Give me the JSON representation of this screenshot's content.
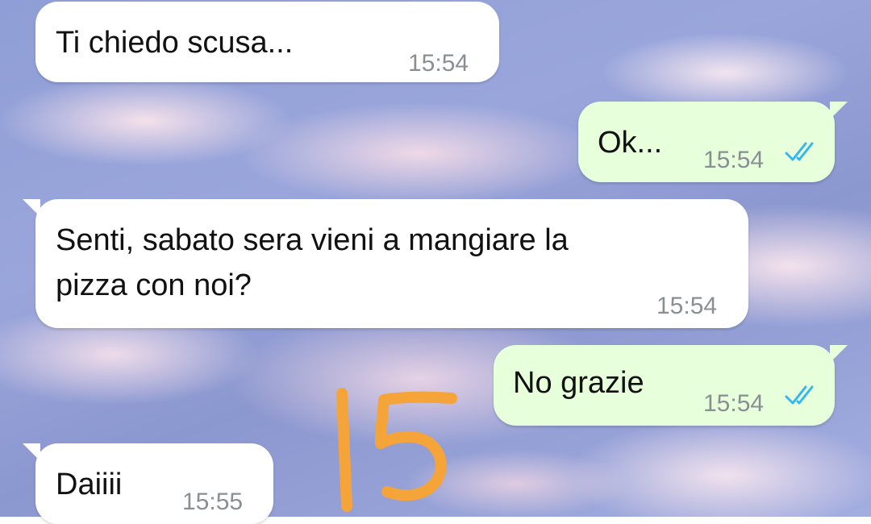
{
  "chat": {
    "messages": [
      {
        "direction": "incoming",
        "text": "Ti chiedo scusa...",
        "time": "15:54"
      },
      {
        "direction": "outgoing",
        "text": "Ok...",
        "time": "15:54",
        "read": true
      },
      {
        "direction": "incoming",
        "text_line1": "Senti, sabato sera vieni a mangiare la",
        "text_line2": "pizza con noi?",
        "time": "15:54"
      },
      {
        "direction": "outgoing",
        "text": "No grazie",
        "time": "15:54",
        "read": true
      },
      {
        "direction": "incoming",
        "text": "Daiiii",
        "time": "15:55"
      }
    ]
  },
  "overlay": {
    "handwritten_number": "15",
    "color": "#f5a43a"
  },
  "colors": {
    "incoming_bubble": "#ffffff",
    "outgoing_bubble": "#e7ffdb",
    "read_ticks": "#34b7f1",
    "timestamp": "#8a8f93"
  }
}
